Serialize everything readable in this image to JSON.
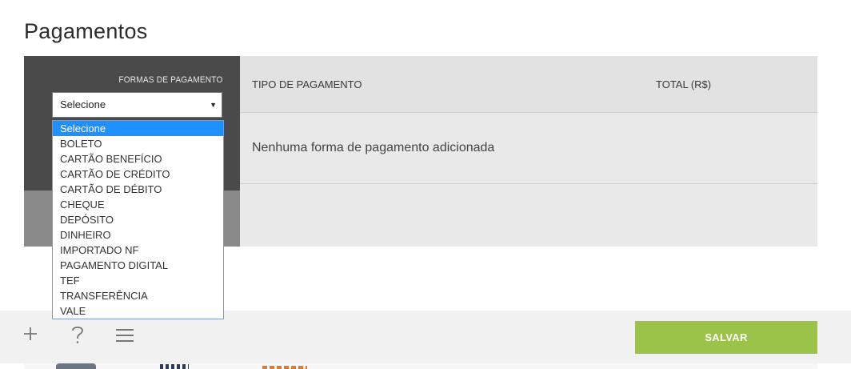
{
  "page": {
    "title": "Pagamentos"
  },
  "payment_forms": {
    "label": "FORMAS DE PAGAMENTO",
    "select_value": "Selecione",
    "options": [
      "Selecione",
      "BOLETO",
      "CARTÃO BENEFÍCIO",
      "CARTÃO DE CRÉDITO",
      "CARTÃO DE DÉBITO",
      "CHEQUE",
      "DEPÓSITO",
      "DINHEIRO",
      "IMPORTADO NF",
      "PAGAMENTO DIGITAL",
      "TEF",
      "TRANSFERÊNCIA",
      "VALE"
    ],
    "highlighted_index": 0
  },
  "table": {
    "headers": {
      "tipo": "TIPO DE PAGAMENTO",
      "total": "TOTAL (R$)"
    },
    "empty_message": "Nenhuma forma de pagamento adicionada"
  },
  "toolbar": {
    "add_icon": "plus-icon",
    "help_icon": "question-icon",
    "menu_icon": "hamburger-menu-icon",
    "save_label": "SALVAR"
  },
  "colors": {
    "save_button": "#9bc34a",
    "dark_panel": "#4a4a4a",
    "dropdown_highlight": "#1e90ff"
  }
}
